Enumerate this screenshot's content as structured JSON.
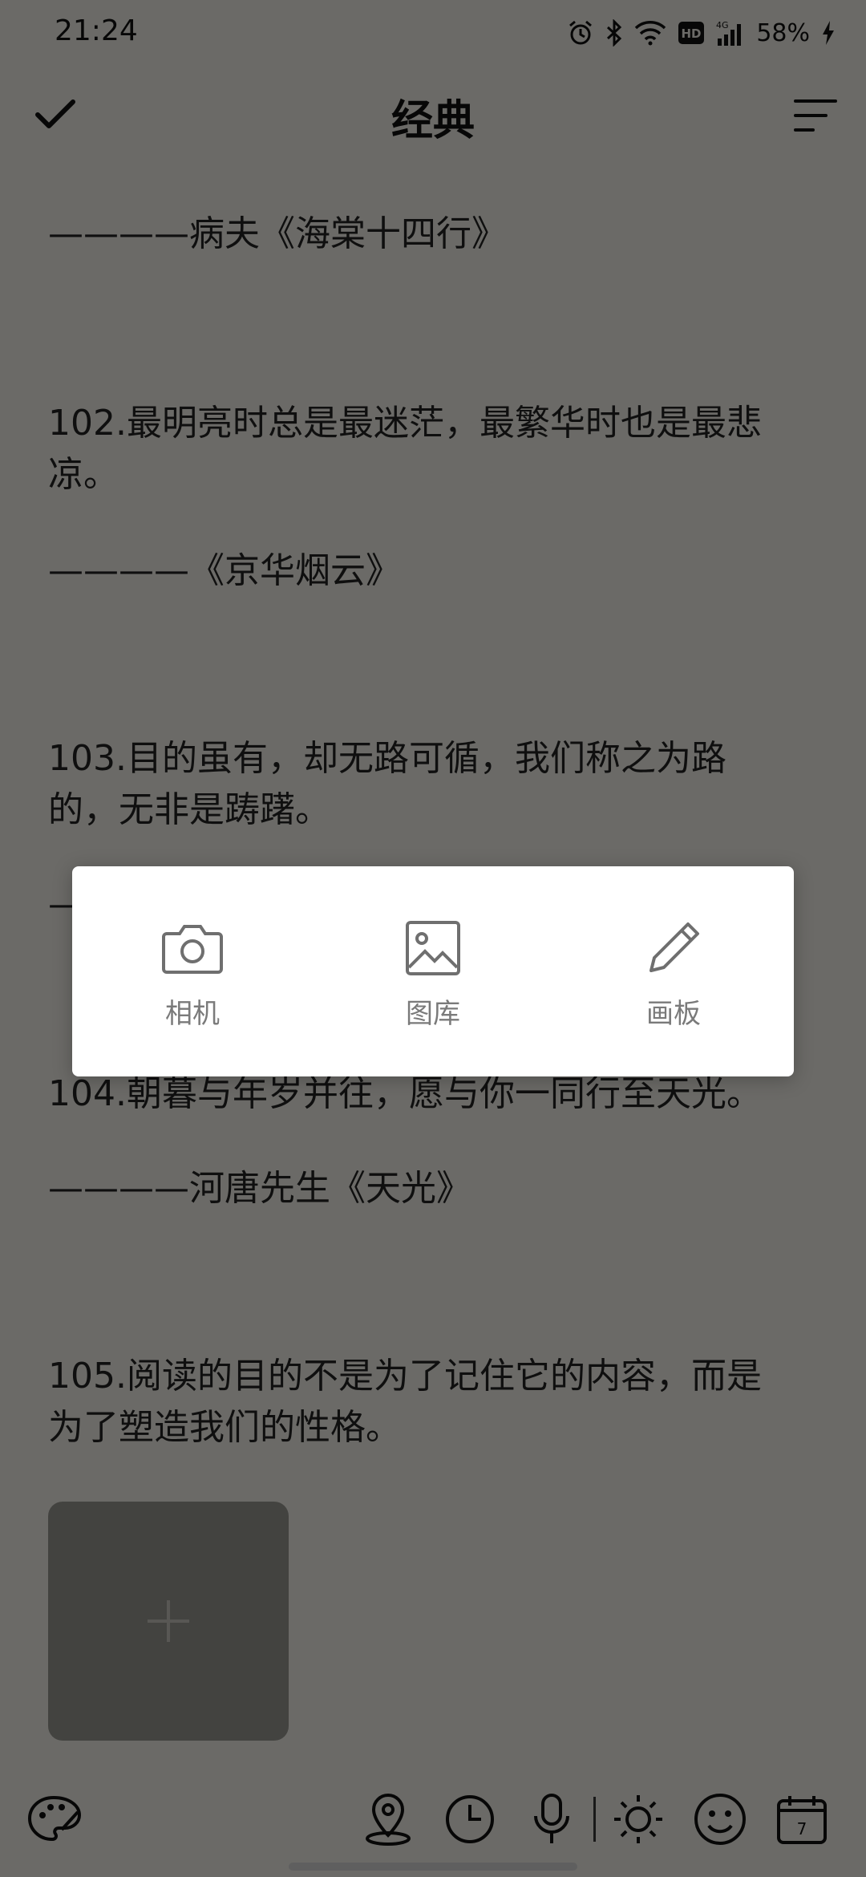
{
  "status_bar": {
    "time": "21:24",
    "battery": "58%",
    "icons": [
      "alarm-icon",
      "bluetooth-icon",
      "wifi-icon",
      "hd-icon",
      "4g-signal-icon",
      "battery-charging-icon"
    ]
  },
  "header": {
    "title": "经典",
    "confirm_icon": "check-icon",
    "sort_icon": "sort-lines-icon"
  },
  "note": {
    "lines": [
      "————病夫《海棠十四行》",
      "102.最明亮时总是最迷茫，最繁华时也是最悲",
      "凉。",
      "————《京华烟云》",
      "103.目的虽有，却无路可循，我们称之为路",
      "的，无非是踌躇。",
      "—",
      "104.朝暮与年岁并往，愿与你一同行至天光。",
      "————河唐先生《天光》",
      "105.阅读的目的不是为了记住它的内容，而是",
      "为了塑造我们的性格。"
    ],
    "add_image_icon": "plus-icon"
  },
  "popup": {
    "options": [
      {
        "label": "相机",
        "icon": "camera-icon"
      },
      {
        "label": "图库",
        "icon": "gallery-icon"
      },
      {
        "label": "画板",
        "icon": "pencil-icon"
      }
    ]
  },
  "toolbar": {
    "icons": [
      "palette-icon",
      "location-icon",
      "clock-icon",
      "microphone-icon",
      "weather-sun-icon",
      "emoji-icon",
      "calendar-icon"
    ],
    "calendar_day": "7"
  },
  "colors": {
    "background": "#f3f2ea",
    "scrim": "rgba(0,0,0,0.56)",
    "popup_bg": "#ffffff",
    "popup_text": "#7a7a7a"
  }
}
